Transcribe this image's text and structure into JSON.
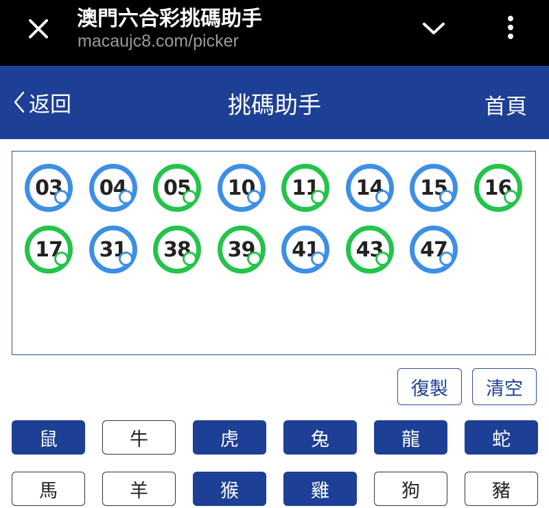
{
  "browser": {
    "title": "澳門六合彩挑碼助手",
    "url": "macaujc8.com/picker",
    "close_icon": "close-icon",
    "chevron_icon": "chevron-down-icon",
    "more_icon": "more-vertical-icon"
  },
  "header": {
    "back_label": "返回",
    "title": "挑碼助手",
    "home_label": "首頁"
  },
  "colors": {
    "primary": "#1d3f95",
    "ball_blue": "#3d8fe6",
    "ball_green": "#24c34a"
  },
  "picked": [
    {
      "num": "03",
      "color": "blue"
    },
    {
      "num": "04",
      "color": "blue"
    },
    {
      "num": "05",
      "color": "green"
    },
    {
      "num": "10",
      "color": "blue"
    },
    {
      "num": "11",
      "color": "green"
    },
    {
      "num": "14",
      "color": "blue"
    },
    {
      "num": "15",
      "color": "blue"
    },
    {
      "num": "16",
      "color": "green"
    },
    {
      "num": "17",
      "color": "green"
    },
    {
      "num": "31",
      "color": "blue"
    },
    {
      "num": "38",
      "color": "green"
    },
    {
      "num": "39",
      "color": "green"
    },
    {
      "num": "41",
      "color": "blue"
    },
    {
      "num": "43",
      "color": "green"
    },
    {
      "num": "47",
      "color": "blue"
    }
  ],
  "actions": {
    "copy_label": "復製",
    "clear_label": "清空"
  },
  "zodiacs": [
    {
      "label": "鼠",
      "selected": true
    },
    {
      "label": "牛",
      "selected": false
    },
    {
      "label": "虎",
      "selected": true
    },
    {
      "label": "兔",
      "selected": true
    },
    {
      "label": "龍",
      "selected": true
    },
    {
      "label": "蛇",
      "selected": true
    },
    {
      "label": "馬",
      "selected": false
    },
    {
      "label": "羊",
      "selected": false
    },
    {
      "label": "猴",
      "selected": true
    },
    {
      "label": "雞",
      "selected": true
    },
    {
      "label": "狗",
      "selected": false
    },
    {
      "label": "豬",
      "selected": false
    }
  ]
}
